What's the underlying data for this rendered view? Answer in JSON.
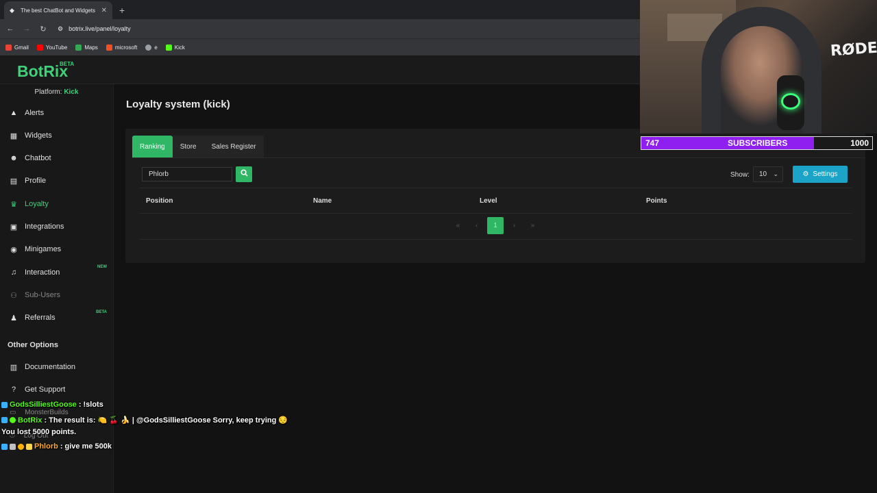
{
  "browser": {
    "tab_title": "The best ChatBot and Widgets",
    "url": "botrix.live/panel/loyalty",
    "bookmarks": [
      {
        "label": "Gmail",
        "color": "#ea4335"
      },
      {
        "label": "YouTube",
        "color": "#ff0000"
      },
      {
        "label": "Maps",
        "color": "#34a853"
      },
      {
        "label": "microsoft",
        "color": "#f25022"
      },
      {
        "label": "e",
        "color": "#9aa0a6"
      },
      {
        "label": "Kick",
        "color": "#53fc18"
      }
    ]
  },
  "brand": {
    "name": "BotRix",
    "badge": "BETA"
  },
  "sidebar": {
    "platform_label": "Platform:",
    "platform_value": "Kick",
    "items": [
      {
        "label": "Alerts",
        "icon": "warning-icon"
      },
      {
        "label": "Widgets",
        "icon": "grid-icon"
      },
      {
        "label": "Chatbot",
        "icon": "robot-icon"
      },
      {
        "label": "Profile",
        "icon": "id-card-icon"
      },
      {
        "label": "Loyalty",
        "icon": "trophy-icon"
      },
      {
        "label": "Integrations",
        "icon": "document-icon"
      },
      {
        "label": "Minigames",
        "icon": "gamepad-icon"
      },
      {
        "label": "Interaction",
        "icon": "music-icon",
        "tag": "NEW"
      },
      {
        "label": "Sub-Users",
        "icon": "users-icon"
      },
      {
        "label": "Referrals",
        "icon": "user-plus-icon",
        "tag": "BETA"
      }
    ],
    "other_title": "Other Options",
    "other_items": [
      {
        "label": "Documentation",
        "icon": "book-icon"
      },
      {
        "label": "Get Support",
        "icon": "help-icon"
      }
    ],
    "account_name": "MonsterBuilds",
    "logout_label": "Log Out"
  },
  "main": {
    "title": "Loyalty system (kick)",
    "tabs": [
      "Ranking",
      "Store",
      "Sales Register"
    ],
    "search_value": "Phlorb",
    "show_label": "Show:",
    "show_value": "10",
    "settings_label": "Settings",
    "columns": [
      "Position",
      "Name",
      "Level",
      "Points"
    ],
    "pagination": {
      "first": "«",
      "prev": "‹",
      "current": "1",
      "next": "›",
      "last": "»"
    }
  },
  "overlay": {
    "subscribers": {
      "current": "747",
      "label": "SUBSCRIBERS",
      "goal": "1000",
      "progress": 0.747
    },
    "mic_brand": "RØDE",
    "chat": [
      {
        "user": "GodsSilliestGoose",
        "sep": ":",
        "text": "!slots",
        "user_color": "#53fc18"
      },
      {
        "user": "BotRix",
        "sep": ":",
        "text": "The result is:  🍋  🍒  🍌  | @GodsSilliestGoose Sorry, keep trying  😔",
        "user_color": "#53fc18"
      },
      {
        "user": "",
        "sep": "",
        "text": "You lost 5000 points.",
        "user_color": "#ffffff"
      },
      {
        "user": "Phlorb",
        "sep": ":",
        "text": "give me 500k",
        "user_color": "#ffa726"
      }
    ]
  },
  "colors": {
    "accent": "#2fb765",
    "info": "#1ba4c8",
    "purple": "#8e1ff0"
  }
}
